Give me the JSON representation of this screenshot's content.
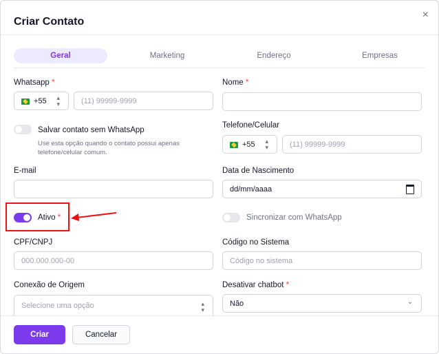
{
  "modal": {
    "title": "Criar Contato",
    "close": "×"
  },
  "tabs": [
    "Geral",
    "Marketing",
    "Endereço",
    "Empresas"
  ],
  "fields": {
    "whatsapp": {
      "label": "Whatsapp",
      "req": "*",
      "ddi": "+55",
      "placeholder": "(11) 99999-9999"
    },
    "nome": {
      "label": "Nome",
      "req": "*"
    },
    "salvar_sem_whatsapp": {
      "label": "Salvar contato sem WhatsApp",
      "hint1": "Use esta opção quando o contato possui apenas",
      "hint2": "telefone/celular comum."
    },
    "telefone": {
      "label": "Telefone/Celular",
      "ddi": "+55",
      "placeholder": "(11) 99999-9999"
    },
    "email": {
      "label": "E-mail"
    },
    "nascimento": {
      "label": "Data de Nascimento",
      "value": "dd/mm/aaaa"
    },
    "ativo": {
      "label": "Ativo",
      "req": "*"
    },
    "sincronizar": {
      "label": "Sincronizar com WhatsApp"
    },
    "cpf": {
      "label": "CPF/CNPJ",
      "placeholder": "000.000.000-00"
    },
    "codigo": {
      "label": "Código no Sistema",
      "placeholder": "Código no sistema"
    },
    "conexao": {
      "label": "Conexão de Origem",
      "placeholder": "Selecione uma opção"
    },
    "chatbot": {
      "label": "Desativar chatbot",
      "req": "*",
      "value": "Não"
    }
  },
  "buttons": {
    "create": "Criar",
    "cancel": "Cancelar"
  },
  "colors": {
    "accent": "#7c3aed",
    "highlight": "#ef1111"
  }
}
